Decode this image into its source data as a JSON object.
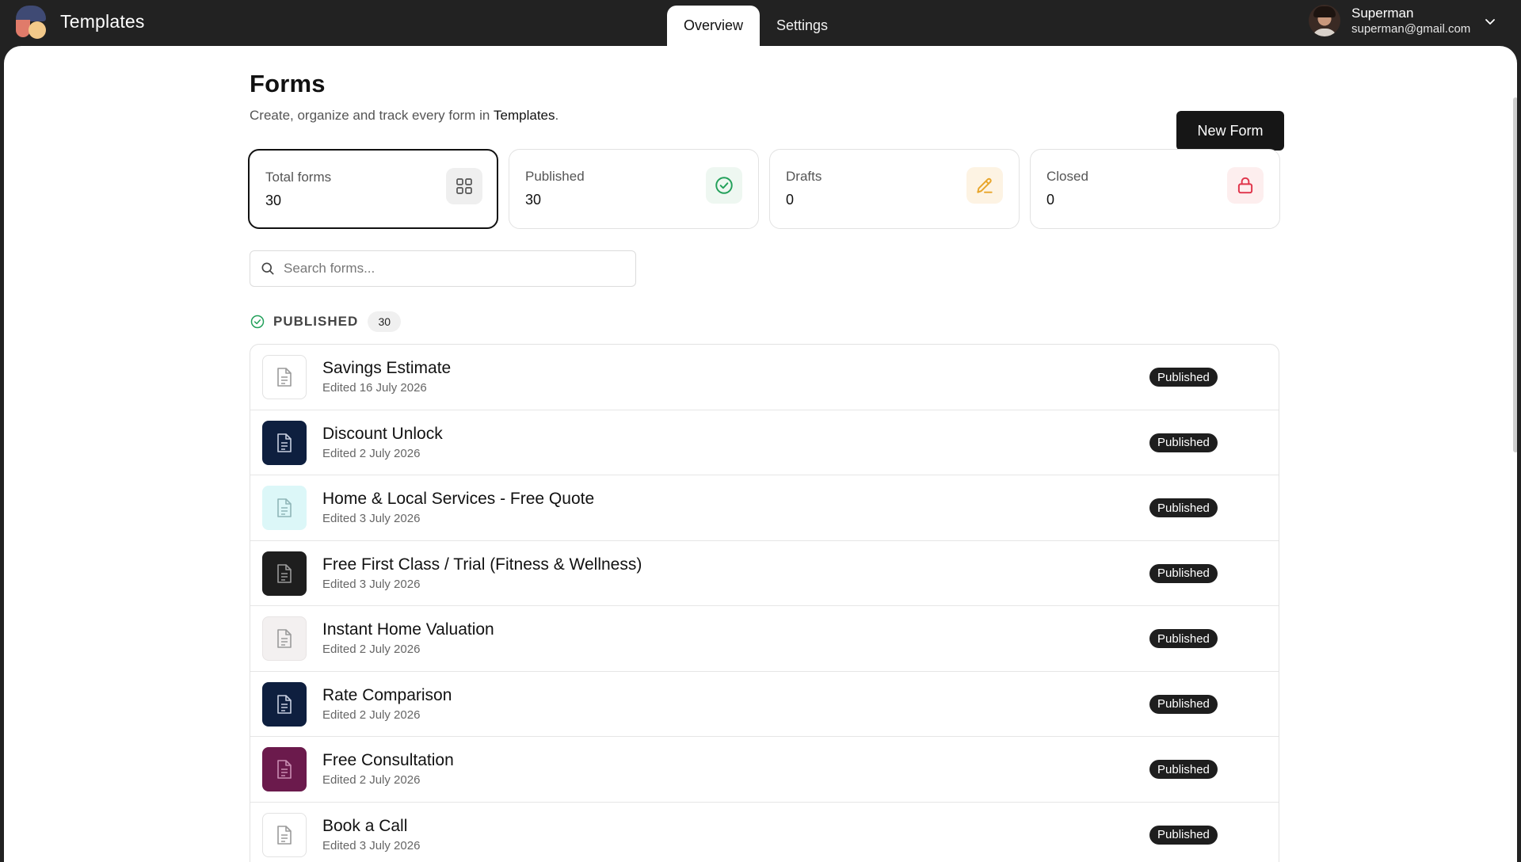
{
  "app": {
    "name": "Templates"
  },
  "nav": {
    "tabs": [
      {
        "label": "Overview"
      },
      {
        "label": "Settings"
      }
    ]
  },
  "user": {
    "name": "Superman",
    "email": "superman@gmail.com"
  },
  "page": {
    "title": "Forms",
    "subtitle_prefix": "Create, organize and track every form in ",
    "subtitle_brand": "Templates",
    "subtitle_suffix": ".",
    "new_form_label": "New Form"
  },
  "stats": [
    {
      "label": "Total forms",
      "value": "30",
      "icon": "grid-icon"
    },
    {
      "label": "Published",
      "value": "30",
      "icon": "check-circle-icon",
      "color": "#22a05a"
    },
    {
      "label": "Drafts",
      "value": "0",
      "icon": "pencil-icon",
      "color": "#e8a52a"
    },
    {
      "label": "Closed",
      "value": "0",
      "icon": "lock-icon",
      "color": "#e0344a"
    }
  ],
  "search": {
    "placeholder": "Search forms..."
  },
  "section": {
    "label": "PUBLISHED",
    "count": "30"
  },
  "forms": [
    {
      "name": "Savings Estimate",
      "edited": "Edited 16 July 2026",
      "status": "Published",
      "thumb": "white"
    },
    {
      "name": "Discount Unlock",
      "edited": "Edited 2 July 2026",
      "status": "Published",
      "thumb": "navy"
    },
    {
      "name": "Home & Local Services - Free Quote",
      "edited": "Edited 3 July 2026",
      "status": "Published",
      "thumb": "cyan"
    },
    {
      "name": "Free First Class / Trial (Fitness & Wellness)",
      "edited": "Edited 3 July 2026",
      "status": "Published",
      "thumb": "black"
    },
    {
      "name": "Instant Home Valuation",
      "edited": "Edited 2 July 2026",
      "status": "Published",
      "thumb": "lightgrey"
    },
    {
      "name": "Rate Comparison",
      "edited": "Edited 2 July 2026",
      "status": "Published",
      "thumb": "navy"
    },
    {
      "name": "Free Consultation",
      "edited": "Edited 2 July 2026",
      "status": "Published",
      "thumb": "plum"
    },
    {
      "name": "Book a Call",
      "edited": "Edited 3 July 2026",
      "status": "Published",
      "thumb": "white"
    }
  ]
}
